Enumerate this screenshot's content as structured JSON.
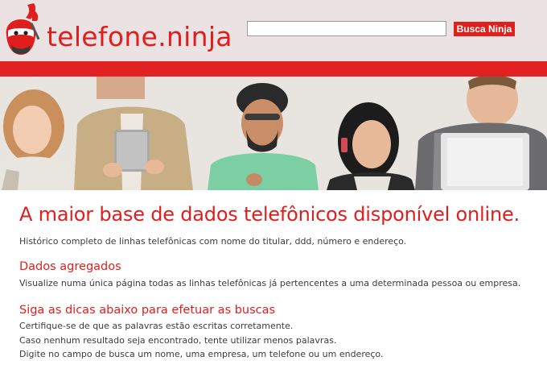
{
  "header": {
    "logo_text": "telefone.ninja",
    "search": {
      "value": "",
      "placeholder": ""
    },
    "search_button_label": "Busca Ninja"
  },
  "colors": {
    "brand_red": "#e01e1e",
    "header_bg": "#ebe3e3",
    "red_bar": "#e22222"
  },
  "main": {
    "headline": "A maior base de dados telefônicos disponível online.",
    "lead": "Histórico completo de linhas telefônicas com nome do titular, ddd, número e endereço.",
    "sections": [
      {
        "title": "Dados agregados",
        "text": "Visualize numa única página todas as linhas telefônicas já pertencentes a uma determinada pessoa ou empresa."
      },
      {
        "title": "Siga as dicas abaixo para efetuar as buscas",
        "items": [
          "Certifique-se de que as palavras estão escritas corretamente.",
          "Caso nenhum resultado seja encontrado, tente utilizar menos palavras.",
          "Digite no campo de busca um nome, uma empresa, um telefone ou um endereço."
        ]
      }
    ]
  },
  "icons": {
    "logo": "ninja-mascot-icon"
  }
}
